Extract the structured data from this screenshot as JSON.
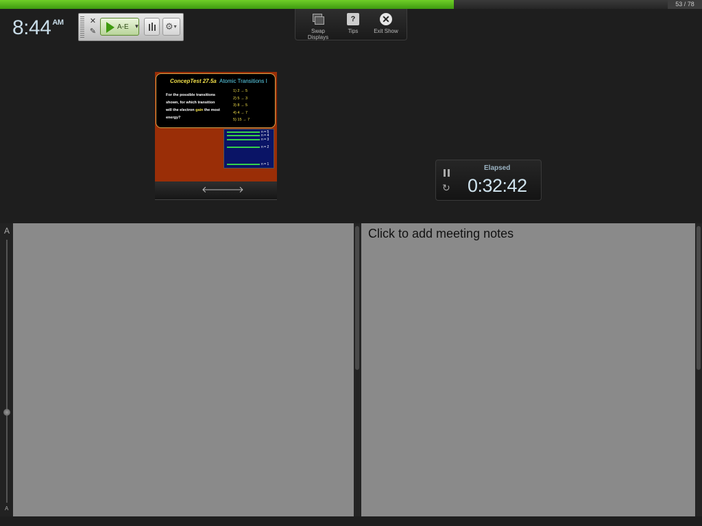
{
  "progress": {
    "fraction": 0.647,
    "slide_count": "53 / 78"
  },
  "clock": {
    "time": "8:44",
    "ampm": "AM"
  },
  "toolbar": {
    "close_icon": "close-icon",
    "edit_icon": "edit-icon",
    "poll_button_label": "A-E",
    "chart_icon": "bar-chart-icon",
    "settings_icon": "gear-icon"
  },
  "top_menu": {
    "swap_displays": "Swap Displays",
    "tips": "Tips",
    "tips_glyph": "?",
    "exit_show": "Exit Show",
    "exit_glyph": "✕"
  },
  "slide": {
    "title": "ConcepTest 27.5a",
    "subtitle": "Atomic Transitions I",
    "question_before": "For the possible transitions shown, for which transition will the electron ",
    "question_highlight": "gain",
    "question_after": " the most energy?",
    "options": [
      "1)  2 → 5",
      "2)  5 → 3",
      "3)  8 → 5",
      "4)  4 → 7",
      "5)  15 → 7"
    ],
    "levels": [
      "n = 5",
      "n = 4",
      "n = 3",
      "n = 2",
      "n = 1"
    ],
    "prev_icon": "arrow-left-icon",
    "next_icon": "arrow-right-icon"
  },
  "timer": {
    "label": "Elapsed",
    "value": "0:32:42",
    "pause_icon": "pause-icon",
    "reset_icon": "reset-icon"
  },
  "font_slider": {
    "large_label": "A",
    "small_label": "A"
  },
  "notes": {
    "placeholder": "Click to add meeting notes"
  }
}
